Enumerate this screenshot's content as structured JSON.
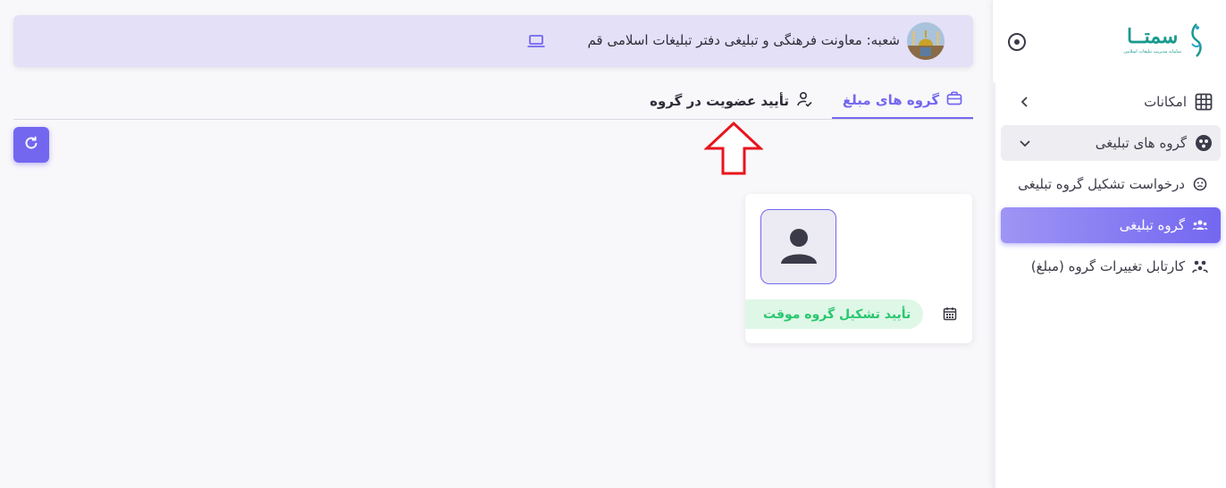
{
  "sidebar": {
    "logo_text": "سمتــا",
    "logo_subtitle": "سامانه مدیریت تبلیغات اسلامی",
    "items": [
      {
        "label": "امکانات",
        "icon": "grid-icon",
        "chevron": "chevron-left-icon"
      },
      {
        "label": "گروه های تبلیغی",
        "icon": "group-circle-icon",
        "chevron": "chevron-down-icon"
      }
    ],
    "subitems": [
      {
        "label": "درخواست تشکیل گروه تبلیغی",
        "icon": "smile-circle-icon"
      },
      {
        "label": "گروه تبلیغی",
        "icon": "users-icon"
      },
      {
        "label": "کارتابل تغییرات گروه (مبلغ)",
        "icon": "users-switch-icon"
      }
    ]
  },
  "topbar": {
    "branch_text": "شعبه: معاونت فرهنگی و تبلیغی دفتر تبلیغات اسلامی قم",
    "laptop_icon": "laptop-icon"
  },
  "tabs": [
    {
      "label": "گروه های مبلغ",
      "icon": "briefcase-icon"
    },
    {
      "label": "تأیید عضویت در گروه",
      "icon": "user-check-icon"
    }
  ],
  "card": {
    "status": "تأیید تشکیل گروه موقت",
    "calendar_icon": "calendar-icon"
  },
  "colors": {
    "accent": "#7367f0",
    "topbar_bg": "#e4e0f7",
    "success": "#28c76f",
    "success_bg": "#dff7e7",
    "arrow": "#e8141d",
    "logo": "#1a9a8e"
  }
}
